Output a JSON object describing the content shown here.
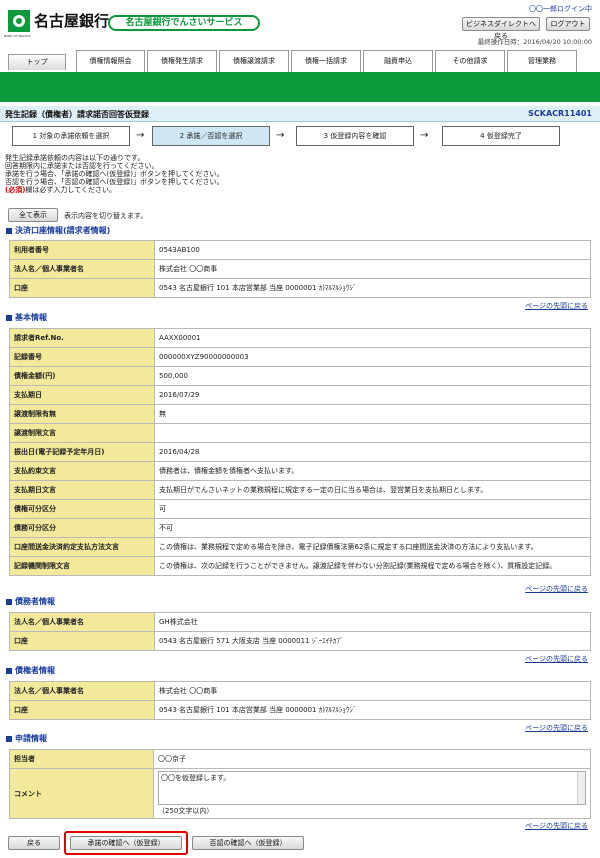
{
  "header": {
    "bank_name": "名古屋銀行",
    "logo_sub": "BANK OF NAGOYA",
    "service_name": "名古屋銀行でんさいサービス",
    "user": "〇〇一郎ログイン中",
    "direct_button": "ビジネスダイレクトへ戻る",
    "logout_button": "ログアウト",
    "last_op": "最終操作日時：2016/04/20 10:00:00"
  },
  "tabs": [
    {
      "label": "トップ",
      "active": false
    },
    {
      "label": "債権情報照会",
      "active": true
    },
    {
      "label": "債権発生請求",
      "active": true
    },
    {
      "label": "債権譲渡請求",
      "active": true
    },
    {
      "label": "債権一括請求",
      "active": true
    },
    {
      "label": "融資申込",
      "active": true
    },
    {
      "label": "その他請求",
      "active": true
    },
    {
      "label": "管理業務",
      "active": true
    }
  ],
  "page": {
    "title": "発生記録（債権者）請求諾否回答仮登録",
    "code": "SCKACR11401"
  },
  "steps": [
    "1 対象の承諾依頼を選択",
    "2 承諾／否認を選択",
    "3 仮登録内容を確認",
    "4 仮登録完了"
  ],
  "intro": {
    "lines": [
      "発生記録承諾依頼の内容は以下の通りです。",
      "回答期限内に承諾または否認を行ってください。",
      "承諾を行う場合、「承諾の確認へ(仮登録)」ボタンを押してください。",
      "否認を行う場合、「否認の確認へ(仮登録)」ボタンを押してください。"
    ],
    "required_mark": "(必須)",
    "required_text": "欄は必ず入力してください。"
  },
  "show_all": {
    "button": "全て表示",
    "text": "表示内容を切り替えます。"
  },
  "page_top": "ページの先頭に戻る",
  "sections": {
    "account": {
      "title": "決済口座情報(請求者情報)",
      "rows": [
        {
          "label": "利用者番号",
          "value": "0543AB100"
        },
        {
          "label": "法人名／個人事業者名",
          "value": "株式会社 〇〇商事"
        },
        {
          "label": "口座",
          "value": "0543 名古屋銀行 101 本店営業部 当座 0000001 ｶ)ﾏﾙﾏﾙｼｮｳｼﾞ"
        }
      ]
    },
    "basic": {
      "title": "基本情報",
      "rows": [
        {
          "label": "請求者Ref.No.",
          "value": "AAXX00001"
        },
        {
          "label": "記録番号",
          "value": "000000XYZ90000000003"
        },
        {
          "label": "債権金額(円)",
          "value": "500,000"
        },
        {
          "label": "支払期日",
          "value": "2016/07/29"
        },
        {
          "label": "譲渡制限有無",
          "value": "無"
        },
        {
          "label": "譲渡制限文言",
          "value": ""
        },
        {
          "label": "振出日(電子記録予定年月日)",
          "value": "2016/04/28"
        },
        {
          "label": "支払約束文言",
          "value": "債務者は、債権金額を債権者へ支払います。"
        },
        {
          "label": "支払期日文言",
          "value": "支払期日がでんさいネットの業務規程に規定する一定の日に当る場合は、翌営業日を支払期日とします。"
        },
        {
          "label": "債権可分区分",
          "value": "可"
        },
        {
          "label": "債務可分区分",
          "value": "不可"
        },
        {
          "label": "口座間送金決済約定支払方法文言",
          "value": "この債権は、業務規程で定める場合を除き、電子記録債権法第62条に規定する口座間送金決済の方法により支払います。"
        },
        {
          "label": "記録機関制限文言",
          "value": "この債権は、次の記録を行うことができません。譲渡記録を伴わない分割記録(業務規程で定める場合を除く)、質権設定記録。"
        }
      ]
    },
    "debtor": {
      "title": "債務者情報",
      "rows": [
        {
          "label": "法人名／個人事業者名",
          "value": "GH株式会社"
        },
        {
          "label": "口座",
          "value": "0543 名古屋銀行 571 大阪支店 当座 0000011 ｼﾞｰｴｲﾁｶﾌﾞ"
        }
      ]
    },
    "creditor": {
      "title": "債権者情報",
      "rows": [
        {
          "label": "法人名／個人事業者名",
          "value": "株式会社 〇〇商事"
        },
        {
          "label": "口座",
          "value": "0543 名古屋銀行 101 本店営業部 当座 0000001 ｶ)ﾏﾙﾏﾙｼｮｳｼﾞ"
        }
      ]
    },
    "application": {
      "title": "申請情報",
      "person_label": "担当者",
      "person": "〇〇京子",
      "comment_label": "コメント",
      "comment": "〇〇を仮登録します。",
      "comment_limit": "（250文字以内）"
    }
  },
  "footer": {
    "back": "戻る",
    "approve": "承諾の確認へ（仮登録）",
    "deny": "否認の確認へ（仮登録）"
  },
  "colors": {
    "green": "#0a9a3c",
    "accent": "#1a3c9a",
    "label_bg": "#f2e99b",
    "highlight": "#e00000"
  }
}
